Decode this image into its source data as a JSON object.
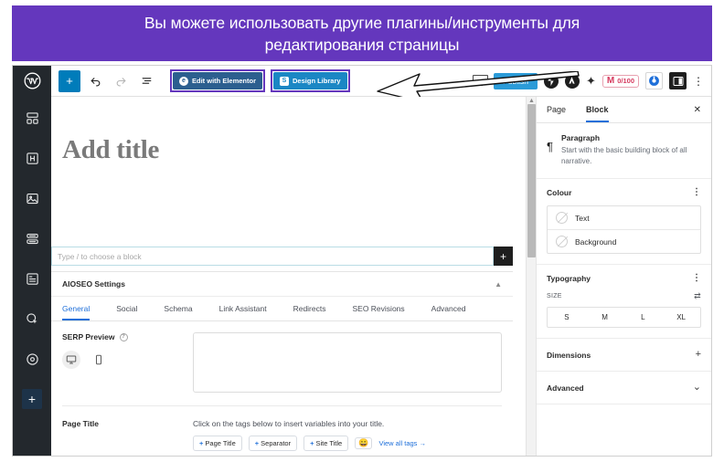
{
  "banner": {
    "line1": "Вы можете использовать другие плагины/инструменты для",
    "line2": "редактирования страницы",
    "bg": "#6437bd",
    "color": "#ffffff"
  },
  "topbar": {
    "wp_logo": "wordpress-logo",
    "add_block_label": "+",
    "undo_label": "↶",
    "redo_label": "↷",
    "list_view_label": "≡",
    "elementor_button": {
      "label": "Edit with Elementor",
      "glyph": "e",
      "bg": "#2c5f8f"
    },
    "design_library_button": {
      "label": "Design Library",
      "glyph": "S",
      "bg": "#1b87c4"
    },
    "publish_label": "Publish",
    "jetpack_glyph": "⚡",
    "akismet_glyph": "A",
    "sparkle_glyph": "✦",
    "score": {
      "value": "0/100",
      "mark": "M",
      "border": "#e8a0b0",
      "color": "#d63a5e"
    },
    "kebab_label": "⋮",
    "highlight_color": "#6437bd"
  },
  "rail": {
    "items": [
      {
        "name": "blocks-icon"
      },
      {
        "name": "heading-icon",
        "glyph": "H"
      },
      {
        "name": "image-icon"
      },
      {
        "name": "columns-icon"
      },
      {
        "name": "list-block-icon"
      },
      {
        "name": "cursor-icon"
      },
      {
        "name": "settings-icon"
      },
      {
        "name": "add-icon",
        "glyph": "+"
      }
    ]
  },
  "canvas": {
    "title_placeholder": "Add title",
    "block_placeholder": "Type / to choose a block",
    "block_add_label": "+"
  },
  "aioseo": {
    "panel_title": "AIOSEO Settings",
    "collapse_caret": "▲",
    "tabs": [
      {
        "label": "General",
        "active": true
      },
      {
        "label": "Social",
        "active": false
      },
      {
        "label": "Schema",
        "active": false
      },
      {
        "label": "Link Assistant",
        "active": false
      },
      {
        "label": "Redirects",
        "active": false
      },
      {
        "label": "SEO Revisions",
        "active": false
      },
      {
        "label": "Advanced",
        "active": false
      }
    ],
    "serp_preview_label": "SERP Preview",
    "help_glyph": "?",
    "page_title_label": "Page Title",
    "page_title_hint": "Click on the tags below to insert variables into your title.",
    "tags": [
      {
        "plus": "+",
        "label": "Page Title"
      },
      {
        "plus": "+",
        "label": "Separator"
      },
      {
        "plus": "+",
        "label": "Site Title"
      }
    ],
    "emoji": "😀",
    "view_all_tags": "View all tags →"
  },
  "sidebar": {
    "tabs": [
      {
        "label": "Page",
        "active": false
      },
      {
        "label": "Block",
        "active": true
      }
    ],
    "close_label": "✕",
    "block": {
      "icon_glyph": "¶",
      "name": "Paragraph",
      "description": "Start with the basic building block of all narrative."
    },
    "colour": {
      "title": "Colour",
      "dots": "⋮",
      "rows": [
        {
          "label": "Text"
        },
        {
          "label": "Background"
        }
      ]
    },
    "typography": {
      "title": "Typography",
      "dots": "⋮",
      "size_label": "SIZE",
      "size_control_glyph": "⇄",
      "sizes": [
        "S",
        "M",
        "L",
        "XL"
      ]
    },
    "dimensions": {
      "title": "Dimensions",
      "mark": "+"
    },
    "advanced": {
      "title": "Advanced",
      "mark": "⌄"
    }
  }
}
